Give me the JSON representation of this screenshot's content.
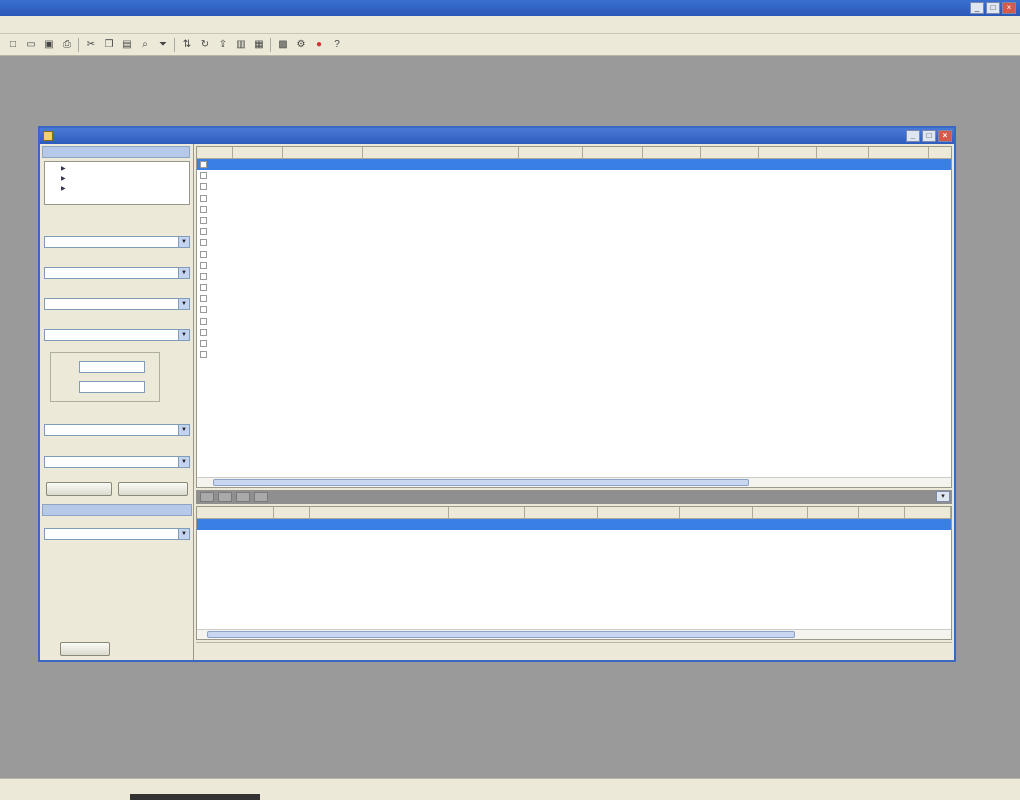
{
  "app": {
    "title": "",
    "window_buttons": [
      "_",
      "□",
      "×"
    ]
  },
  "menu": [
    "",
    "",
    "",
    "",
    "",
    "",
    "",
    "",
    "",
    "",
    "",
    "",
    "",
    "",
    "",
    "",
    "",
    "",
    "",
    ""
  ],
  "toolbar_icons": [
    "new-icon",
    "open-icon",
    "save-icon",
    "print-icon",
    "cut-icon",
    "copy-icon",
    "paste-icon",
    "find-icon",
    "filter-icon",
    "sort-icon",
    "refresh-icon",
    "export-icon",
    "chart-icon",
    "report-icon",
    "calendar-icon",
    "settings-icon",
    "stop-icon",
    "help-icon"
  ],
  "window": {
    "title": "",
    "buttons": [
      "_",
      "□",
      "×"
    ]
  },
  "left_panel": {
    "tab": "",
    "tree": {
      "root": "",
      "children": [
        "",
        "",
        ""
      ]
    },
    "filters": [
      {
        "label": "",
        "value": ""
      },
      {
        "label": "",
        "value": ""
      },
      {
        "label": "",
        "value": ""
      },
      {
        "label": "",
        "value": ""
      }
    ],
    "date_range": {
      "caption": "",
      "from_label": "",
      "from_value": "",
      "to_label": "",
      "to_value": ""
    },
    "filter2": [
      {
        "label": "",
        "value": ""
      },
      {
        "label": "",
        "value": ""
      }
    ],
    "buttons": [
      "",
      ""
    ],
    "lower_tab": "",
    "lower_filter": {
      "label": "",
      "value": ""
    },
    "lower_button": ""
  },
  "top_grid": {
    "columns": [
      "",
      "",
      "",
      "",
      "",
      "",
      "",
      "",
      "",
      "",
      ""
    ],
    "rows": [
      [
        "",
        "",
        "",
        "",
        "",
        "",
        "",
        "",
        "",
        ""
      ],
      [
        "",
        "",
        "",
        "",
        "",
        "",
        "",
        "",
        "",
        ""
      ],
      [
        "",
        "",
        "",
        "",
        "",
        "",
        "",
        "",
        "",
        ""
      ],
      [
        "",
        "",
        "",
        "",
        "",
        "",
        "",
        "",
        "",
        ""
      ],
      [
        "",
        "",
        "",
        "",
        "",
        "",
        "",
        "",
        "",
        ""
      ],
      [
        "",
        "",
        "",
        "",
        "",
        "",
        "",
        "",
        "",
        ""
      ],
      [
        "",
        "",
        "",
        "",
        "",
        "",
        "",
        "",
        "",
        ""
      ],
      [
        "",
        "",
        "",
        "",
        "",
        "",
        "",
        "",
        "",
        ""
      ],
      [
        "",
        "",
        "",
        "",
        "",
        "",
        "",
        "",
        "",
        ""
      ],
      [
        "",
        "",
        "",
        "",
        "",
        "",
        "",
        "",
        "",
        ""
      ],
      [
        "",
        "",
        "",
        "",
        "",
        "",
        "",
        "",
        "",
        ""
      ],
      [
        "",
        "",
        "",
        "",
        "",
        "",
        "",
        "",
        "",
        ""
      ],
      [
        "",
        "",
        "",
        "",
        "",
        "",
        "",
        "",
        "",
        ""
      ],
      [
        "",
        "",
        "",
        "",
        "",
        "",
        "",
        "",
        "",
        ""
      ],
      [
        "",
        "",
        "",
        "",
        "",
        "",
        "",
        "",
        "",
        ""
      ],
      [
        "",
        "",
        "",
        "",
        "",
        "",
        "",
        "",
        "",
        ""
      ],
      [
        "",
        "",
        "",
        "",
        "",
        "",
        "",
        "",
        "",
        ""
      ],
      [
        "",
        "",
        "",
        "",
        "",
        "",
        "",
        "",
        "",
        ""
      ]
    ]
  },
  "mid_tabs": [
    "",
    "",
    "",
    ""
  ],
  "bottom_grid": {
    "columns": [
      "",
      "",
      "",
      "",
      "",
      "",
      "",
      "",
      "",
      "",
      ""
    ],
    "rows": [
      [
        "",
        "",
        "",
        "",
        "",
        "",
        "",
        "",
        "",
        "",
        ""
      ]
    ]
  },
  "window_status": {
    "left": "",
    "right": ""
  },
  "statusbar": {
    "left": "",
    "right": [
      "",
      "",
      ""
    ]
  }
}
